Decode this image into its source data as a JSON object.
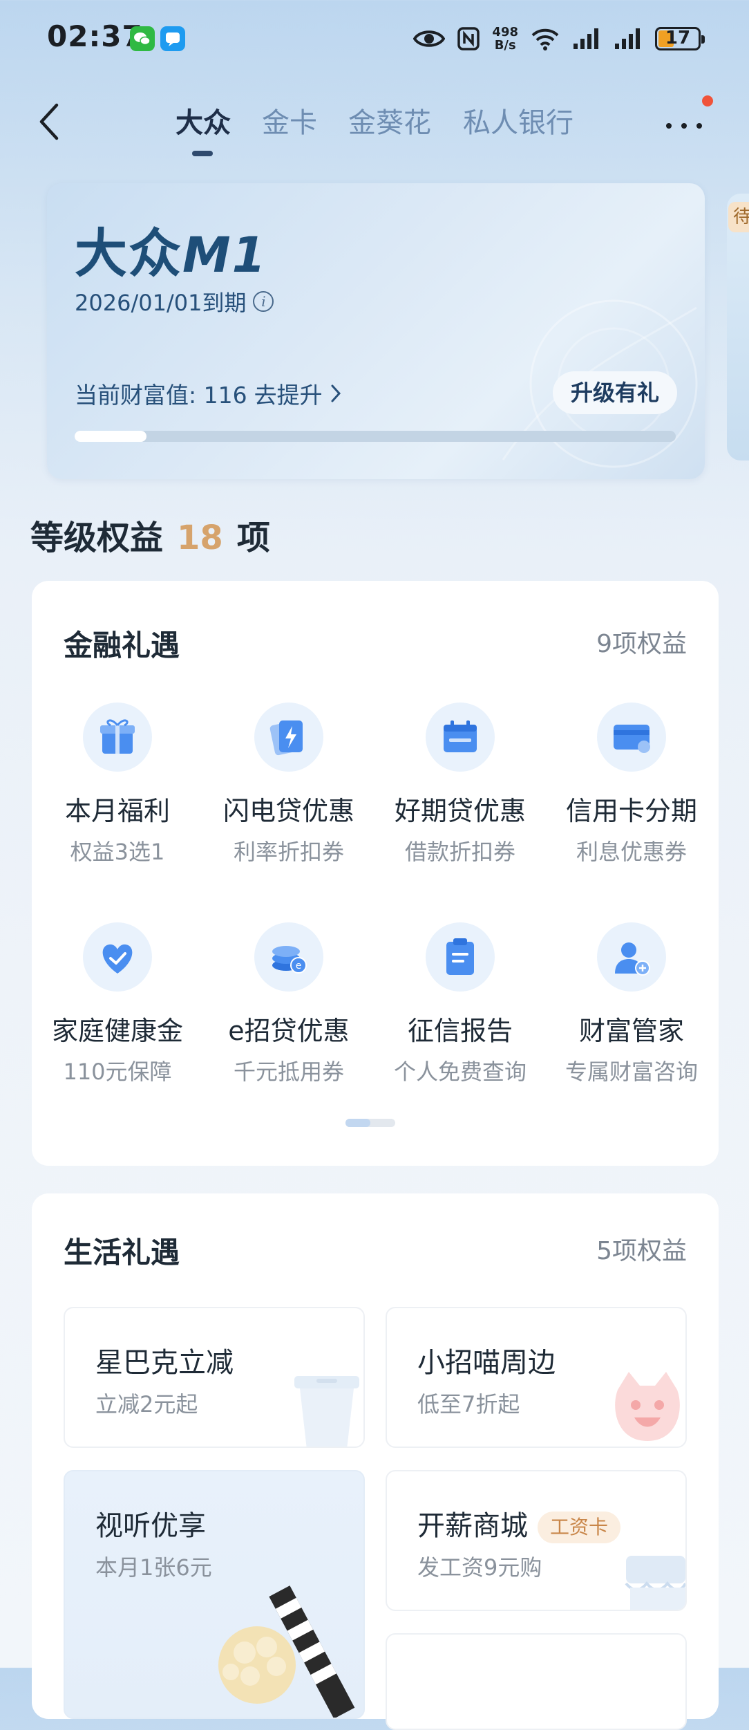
{
  "status_bar": {
    "time": "02:37",
    "net_speed_top": "498",
    "net_speed_bottom": "B/s",
    "battery": "17",
    "icons": [
      "wechat-icon",
      "message-icon",
      "eye-icon",
      "nfc-icon",
      "wifi-icon",
      "signal-icon",
      "signal-icon",
      "battery-icon"
    ]
  },
  "nav": {
    "tabs": [
      "大众",
      "金卡",
      "金葵花",
      "私人银行"
    ],
    "active_tab": "大众",
    "back_icon": "chevron-left-icon",
    "more_icon": "more-dots-icon"
  },
  "level_card": {
    "title": "大众",
    "title_suffix": "M1",
    "expire": "2026/01/01到期",
    "wealth_label": "当前财富值: 116",
    "wealth_action": "去提升",
    "upgrade_button": "升级有礼",
    "progress": 0.12,
    "side_card_tag": "待"
  },
  "benefits": {
    "title_prefix": "等级权益",
    "count": "18",
    "title_suffix": "项"
  },
  "finance": {
    "title": "金融礼遇",
    "count_label": "9项权益",
    "items": [
      {
        "title": "本月福利",
        "sub": "权益3选1",
        "icon": "gift-icon"
      },
      {
        "title": "闪电贷优惠",
        "sub": "利率折扣券",
        "icon": "lightning-card-icon"
      },
      {
        "title": "好期贷优惠",
        "sub": "借款折扣券",
        "icon": "calendar-icon"
      },
      {
        "title": "信用卡分期",
        "sub": "利息优惠券",
        "icon": "credit-card-icon"
      },
      {
        "title": "家庭健康金",
        "sub": "110元保障",
        "icon": "heart-check-icon"
      },
      {
        "title": "e招贷优惠",
        "sub": "千元抵用券",
        "icon": "coins-icon"
      },
      {
        "title": "征信报告",
        "sub": "个人免费查询",
        "icon": "clipboard-icon"
      },
      {
        "title": "财富管家",
        "sub": "专属财富咨询",
        "icon": "advisor-icon"
      }
    ],
    "pager_pages": 2,
    "pager_active": 1
  },
  "life": {
    "title": "生活礼遇",
    "count_label": "5项权益",
    "items": [
      {
        "title": "星巴克立减",
        "sub": "立减2元起",
        "icon": "coffee-cup-icon"
      },
      {
        "title": "小招喵周边",
        "sub": "低至7折起",
        "icon": "cat-icon"
      },
      {
        "title": "视听优享",
        "sub": "本月1张6元",
        "icon": "popcorn-icon"
      },
      {
        "title": "开薪商城",
        "tag": "工资卡",
        "sub": "发工资9元购",
        "icon": "shop-icon"
      }
    ]
  }
}
